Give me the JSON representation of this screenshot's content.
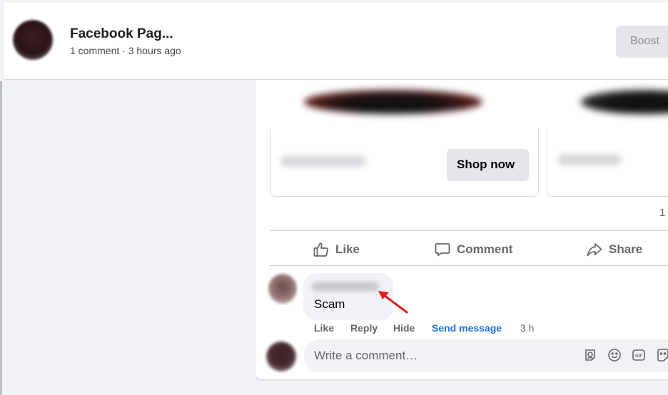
{
  "header": {
    "page_name": "Facebook Pag...",
    "comment_count": "1 comment",
    "separator": " · ",
    "time_ago": "3 hours ago",
    "boost_label": "Boost"
  },
  "products": [
    {
      "shop_label": "Shop now"
    }
  ],
  "reactions_count": "1",
  "actions": {
    "like": "Like",
    "comment": "Comment",
    "share": "Share"
  },
  "comment": {
    "text": "Scam",
    "actions": {
      "like": "Like",
      "reply": "Reply",
      "hide": "Hide",
      "send_message": "Send message",
      "time": "3 h"
    }
  },
  "composer": {
    "placeholder": "Write a comment…"
  },
  "colors": {
    "link_blue": "#1b74e4",
    "muted_text": "#65676b",
    "annotation_arrow": "#e02020"
  },
  "icons": {
    "like": "thumbs-up-icon",
    "comment": "speech-bubble-icon",
    "share": "share-arrow-icon",
    "composer": [
      "avatar-sticker-icon",
      "emoji-icon",
      "gif-icon",
      "sticker-icon"
    ]
  }
}
